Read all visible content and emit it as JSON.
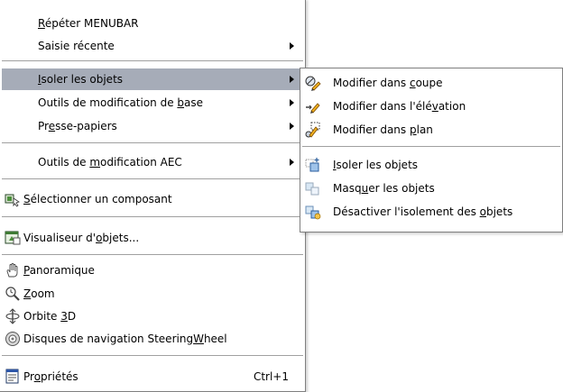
{
  "main_menu": {
    "items": [
      {
        "id": "repeat",
        "pre": "",
        "acc": "R",
        "post": "épéter MENUBAR"
      },
      {
        "id": "recent",
        "pre": "Saisie récente",
        "acc": "",
        "post": ""
      },
      {
        "id": "isolate",
        "pre": "",
        "acc": "I",
        "post": "soler les objets"
      },
      {
        "id": "basic-tools",
        "pre": "Outils de modification de ",
        "acc": "b",
        "post": "ase"
      },
      {
        "id": "clipboard",
        "pre": "Pr",
        "acc": "e",
        "post": "sse-papiers"
      },
      {
        "id": "aec-tools",
        "pre": "Outils de ",
        "acc": "m",
        "post": "odification AEC"
      },
      {
        "id": "select-component",
        "pre": "",
        "acc": "S",
        "post": "électionner un composant"
      },
      {
        "id": "object-viewer",
        "pre": "Visualiseur d'",
        "acc": "o",
        "post": "bjets..."
      },
      {
        "id": "pan",
        "pre": "",
        "acc": "P",
        "post": "anoramique"
      },
      {
        "id": "zoom",
        "pre": "",
        "acc": "Z",
        "post": "oom"
      },
      {
        "id": "orbit",
        "pre": "Orbite ",
        "acc": "3",
        "post": "D"
      },
      {
        "id": "steeringwheel",
        "pre": "Disques de navigation Steering",
        "acc": "W",
        "post": "heel"
      },
      {
        "id": "properties",
        "pre": "Pr",
        "acc": "o",
        "post": "priétés",
        "shortcut": "Ctrl+1"
      }
    ]
  },
  "sub_menu": {
    "items": [
      {
        "id": "edit-section",
        "pre": "Modifier dans ",
        "acc": "c",
        "post": "oupe"
      },
      {
        "id": "edit-elevation",
        "pre": "Modifier dans l'élé",
        "acc": "v",
        "post": "ation"
      },
      {
        "id": "edit-plan",
        "pre": "Modifier dans ",
        "acc": "p",
        "post": "lan"
      },
      {
        "id": "isolate-objects",
        "pre": "",
        "acc": "I",
        "post": "soler les objets"
      },
      {
        "id": "hide-objects",
        "pre": "Masq",
        "acc": "u",
        "post": "er les objets"
      },
      {
        "id": "end-isolation",
        "pre": "Désactiver l'isolement des ",
        "acc": "o",
        "post": "bjets"
      }
    ]
  },
  "colors": {
    "highlight": "#a6acb8",
    "border": "#7f7f7f",
    "separator": "#a0a0a0"
  },
  "icons": {
    "select-component": "select-component-icon",
    "object-viewer": "object-viewer-icon",
    "pan": "pan-hand-icon",
    "zoom": "zoom-magnifier-icon",
    "orbit": "orbit-icon",
    "steeringwheel": "steeringwheel-icon",
    "properties": "properties-icon",
    "edit-section": "edit-in-section-icon",
    "edit-elevation": "edit-in-elevation-icon",
    "edit-plan": "edit-in-plan-icon",
    "isolate-objects": "isolate-objects-icon",
    "hide-objects": "hide-objects-icon",
    "end-isolation": "end-isolation-icon"
  }
}
